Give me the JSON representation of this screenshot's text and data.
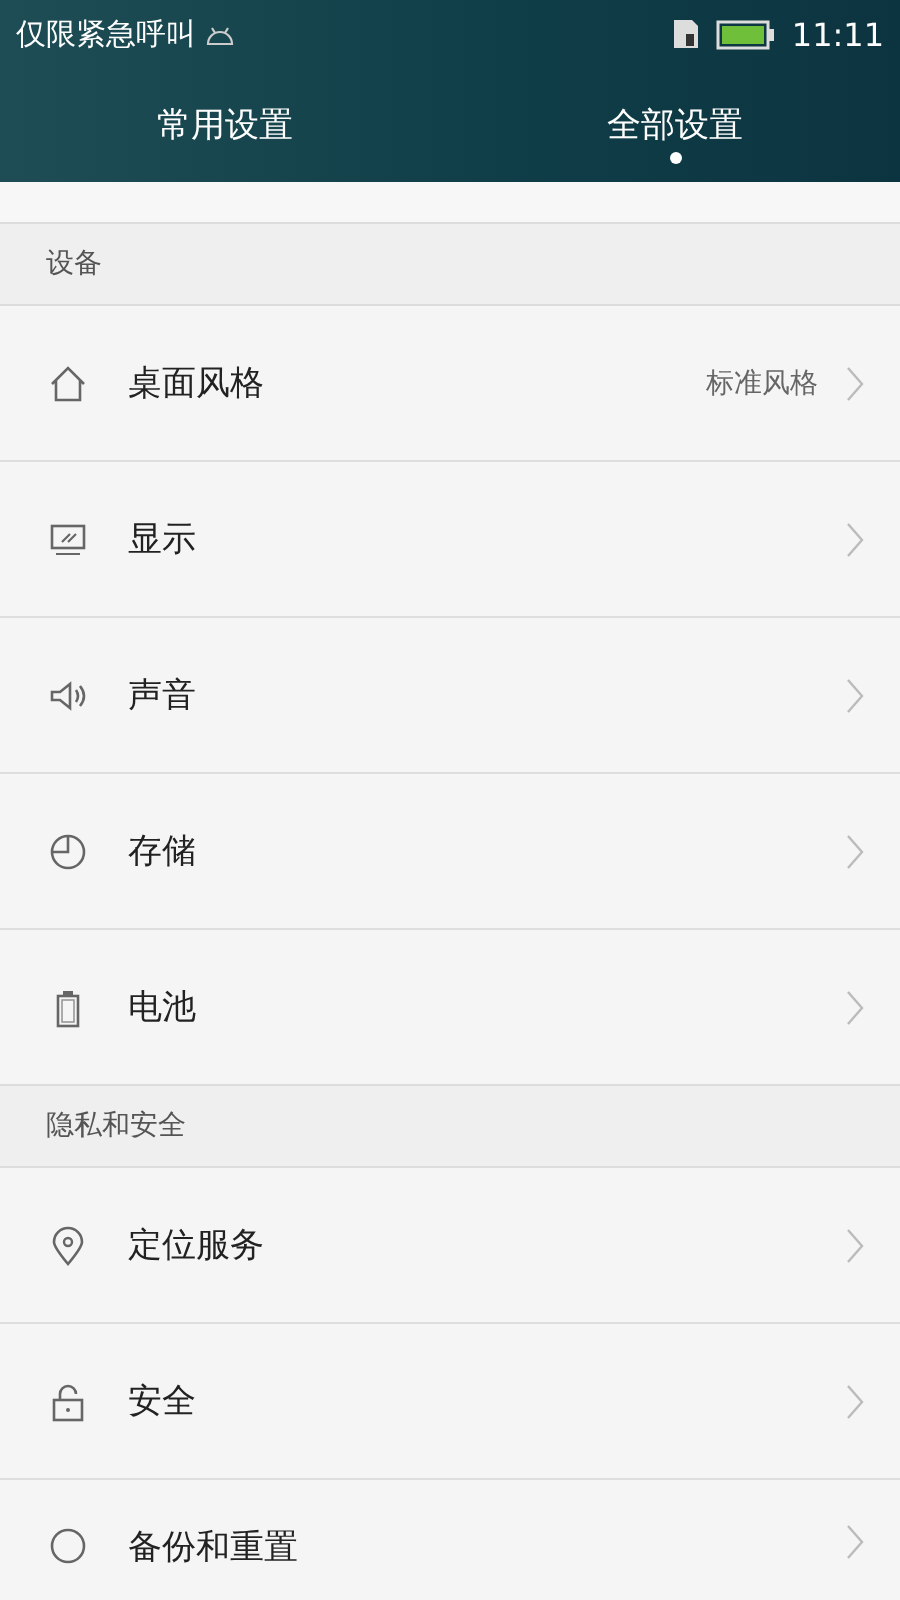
{
  "status_bar": {
    "carrier": "仅限紧急呼叫",
    "time": "11:11"
  },
  "tabs": [
    {
      "label": "常用设置",
      "selected": false
    },
    {
      "label": "全部设置",
      "selected": true
    }
  ],
  "sections": [
    {
      "header": "设备",
      "items": [
        {
          "kind": "house",
          "label": "桌面风格",
          "value": "标准风格"
        },
        {
          "kind": "monitor",
          "label": "显示"
        },
        {
          "kind": "speaker",
          "label": "声音"
        },
        {
          "kind": "pie",
          "label": "存储"
        },
        {
          "kind": "battery",
          "label": "电池"
        }
      ]
    },
    {
      "header": "隐私和安全",
      "items": [
        {
          "kind": "pin",
          "label": "定位服务"
        },
        {
          "kind": "lock",
          "label": "安全"
        },
        {
          "kind": "circle",
          "label": "备份和重置"
        }
      ]
    }
  ]
}
